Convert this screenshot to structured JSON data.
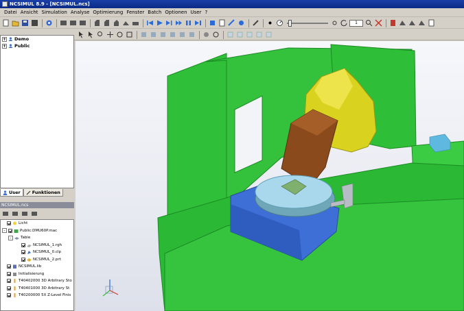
{
  "window": {
    "title": "NCSIMUL 8.9 - [NCSIMUL.ncs]"
  },
  "menu": [
    "Datei",
    "Ansicht",
    "Simulation",
    "Analyse",
    "Optimierung",
    "Fenster",
    "Batch",
    "Optionen",
    "User",
    "?"
  ],
  "toolbar": {
    "step_value": "1"
  },
  "tree": {
    "items": [
      {
        "label": "Demo"
      },
      {
        "label": "Public"
      }
    ]
  },
  "tabs": [
    {
      "label": "User"
    },
    {
      "label": "Funktionen"
    }
  ],
  "scene": {
    "header": "NCSIMUL.ncs",
    "items": [
      {
        "label": "Licht",
        "icon": "light-icon"
      },
      {
        "label": "Public:DMU60P.mac",
        "icon": "machine-icon"
      },
      {
        "label": "Table",
        "icon": "table-icon"
      },
      {
        "label": "NCSIMUL_1.rgh",
        "icon": "rough-icon"
      },
      {
        "label": "NCSIMUL_0.clp",
        "icon": "clamp-icon"
      },
      {
        "label": "NCSIMUL_2.prt",
        "icon": "part-icon"
      },
      {
        "label": "NCSIMUL.lib",
        "icon": "library-icon"
      },
      {
        "label": "Initialisierung",
        "icon": "init-icon"
      },
      {
        "label": "T40402000 3D Arbitrary Sto",
        "icon": "tool-icon"
      },
      {
        "label": "T40401000 3D Arbitrary St",
        "icon": "tool-icon"
      },
      {
        "label": "T40200000 5X Z-Level Finis",
        "icon": "tool-icon"
      }
    ]
  },
  "colors": {
    "machine_green": "#2fbf38",
    "head_yellow": "#d9d31f",
    "spindle_brown": "#8a4a1c",
    "table_blue": "#3d6fd6",
    "rotary_cyan": "#a9d8ec"
  }
}
